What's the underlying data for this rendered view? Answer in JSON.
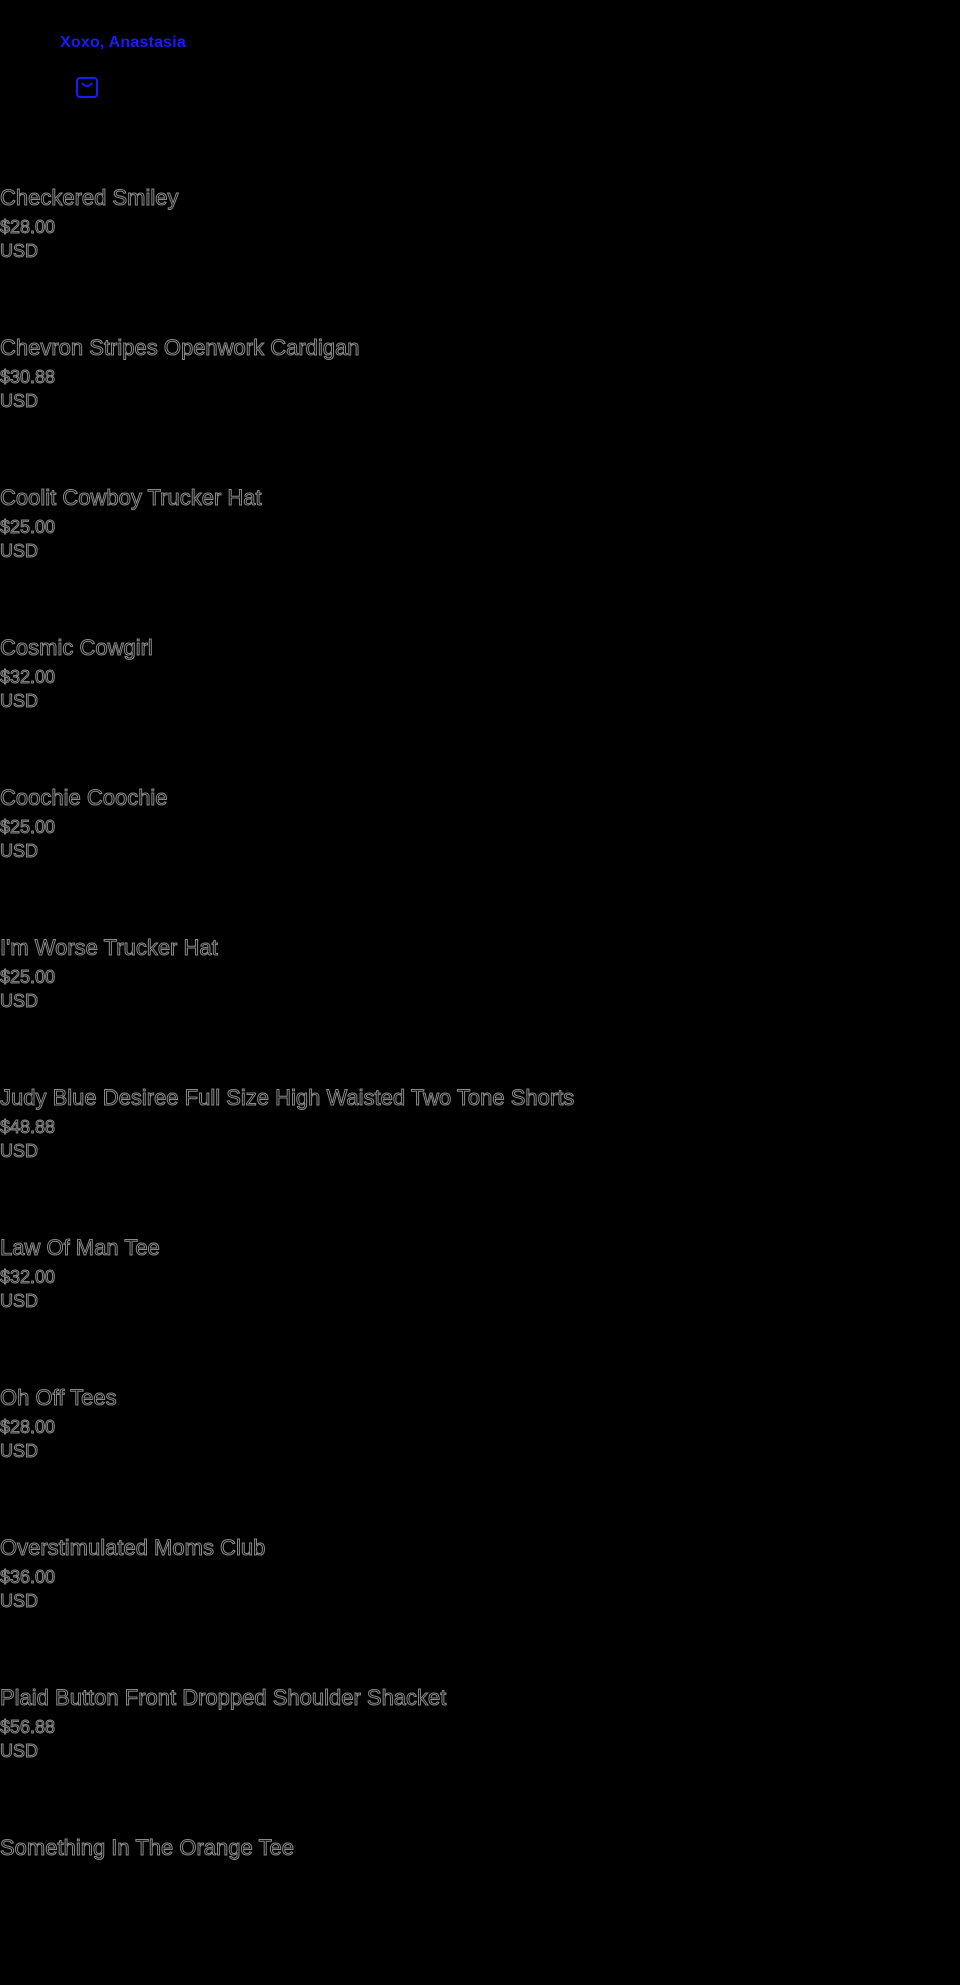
{
  "header": {
    "brand": "Xoxo, Anastasia",
    "cart_icon": "shopping-bag-icon"
  },
  "colors": {
    "background": "#000000",
    "brand_link": "#1a1aff",
    "text_outline": "#8a8a8a"
  },
  "products": [
    {
      "title": "Checkered Smiley",
      "price": "$28.00",
      "currency": "USD"
    },
    {
      "title": "Chevron Stripes Openwork Cardigan",
      "price": "$30.88",
      "currency": "USD"
    },
    {
      "title": "Coolit Cowboy Trucker Hat",
      "price": "$25.00",
      "currency": "USD"
    },
    {
      "title": "Cosmic Cowgirl",
      "price": "$32.00",
      "currency": "USD"
    },
    {
      "title": "Coochie Coochie",
      "price": "$25.00",
      "currency": "USD"
    },
    {
      "title": "I'm Worse Trucker Hat",
      "price": "$25.00",
      "currency": "USD"
    },
    {
      "title": "Judy Blue Desiree Full Size High Waisted Two Tone Shorts",
      "price": "$48.88",
      "currency": "USD"
    },
    {
      "title": "Law Of Man Tee",
      "price": "$32.00",
      "currency": "USD"
    },
    {
      "title": "Oh Off Tees",
      "price": "$28.00",
      "currency": "USD"
    },
    {
      "title": "Overstimulated Moms Club",
      "price": "$36.00",
      "currency": "USD"
    },
    {
      "title": "Plaid Button Front Dropped Shoulder Shacket",
      "price": "$56.88",
      "currency": "USD"
    },
    {
      "title": "Something In The Orange Tee",
      "price": "",
      "currency": ""
    }
  ]
}
